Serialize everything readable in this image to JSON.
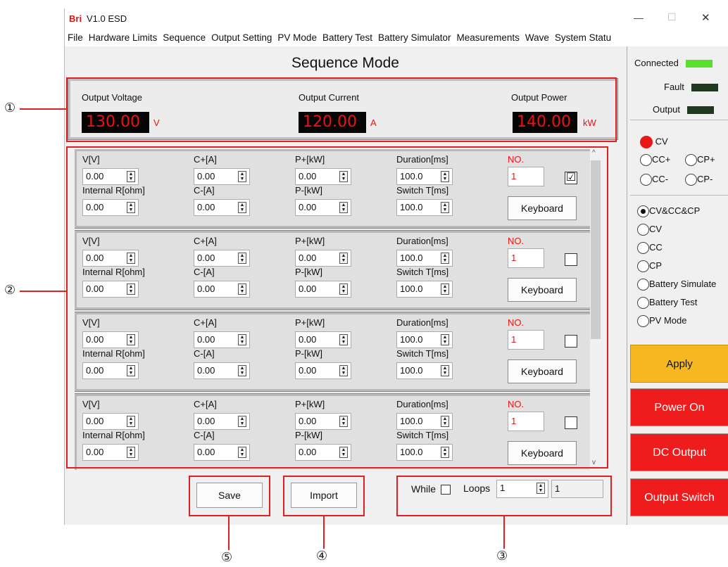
{
  "window": {
    "logo": "Bri",
    "title": "V1.0  ESD",
    "min": "—",
    "max": "☐",
    "close": "✕"
  },
  "menu": [
    "File",
    "Hardware Limits",
    "Sequence",
    "Output Setting",
    "PV Mode",
    "Battery Test",
    "Battery Simulator",
    "Measurements",
    "Wave",
    "System Statu"
  ],
  "page_title": "Sequence Mode",
  "readouts": {
    "voltage": {
      "label": "Output Voltage",
      "value": "130.00",
      "unit": "V"
    },
    "current": {
      "label": "Output Current",
      "value": "120.00",
      "unit": "A"
    },
    "power": {
      "label": "Output Power",
      "value": "140.00",
      "unit": "kW"
    }
  },
  "row_labels": {
    "v": "V[V]",
    "cp": "C+[A]",
    "pp": "P+[kW]",
    "dur": "Duration[ms]",
    "no": "NO.",
    "ir": "Internal R[ohm]",
    "cm": "C-[A]",
    "pm": "P-[kW]",
    "sw": "Switch T[ms]",
    "keyboard": "Keyboard"
  },
  "rows": [
    {
      "v": "0.00",
      "cp": "0.00",
      "pp": "0.00",
      "dur": "100.0",
      "no": "1",
      "ir": "0.00",
      "cm": "0.00",
      "pm": "0.00",
      "sw": "100.0",
      "checked": "☑"
    },
    {
      "v": "0.00",
      "cp": "0.00",
      "pp": "0.00",
      "dur": "100.0",
      "no": "1",
      "ir": "0.00",
      "cm": "0.00",
      "pm": "0.00",
      "sw": "100.0",
      "checked": ""
    },
    {
      "v": "0.00",
      "cp": "0.00",
      "pp": "0.00",
      "dur": "100.0",
      "no": "1",
      "ir": "0.00",
      "cm": "0.00",
      "pm": "0.00",
      "sw": "100.0",
      "checked": ""
    },
    {
      "v": "0.00",
      "cp": "0.00",
      "pp": "0.00",
      "dur": "100.0",
      "no": "1",
      "ir": "0.00",
      "cm": "0.00",
      "pm": "0.00",
      "sw": "100.0",
      "checked": ""
    }
  ],
  "bottom": {
    "save": "Save",
    "import": "Import",
    "while": "While",
    "loops": "Loops",
    "loops_value": "1",
    "loops_count": "1"
  },
  "status": {
    "connected": "Connected",
    "fault": "Fault",
    "output": "Output"
  },
  "mode_radios": {
    "cv": "CV",
    "ccp": "CC+",
    "cpp": "CP+",
    "ccm": "CC-",
    "cpm": "CP-"
  },
  "type_radios": [
    "CV&CC&CP",
    "CV",
    "CC",
    "CP",
    "Battery Simulate",
    "Battery Test",
    "PV Mode"
  ],
  "buttons": {
    "apply": "Apply",
    "power_on": "Power On",
    "dc_output": "DC Output",
    "output_switch": "Output Switch"
  },
  "callouts": {
    "c1": "①",
    "c2": "②",
    "c3": "③",
    "c4": "④",
    "c5": "⑤"
  },
  "colors": {
    "accent_red": "#e02020",
    "lcd_text": "#e11111",
    "apply": "#f5b820",
    "led_on": "#59e02a",
    "led_off": "#1e3a1e"
  }
}
